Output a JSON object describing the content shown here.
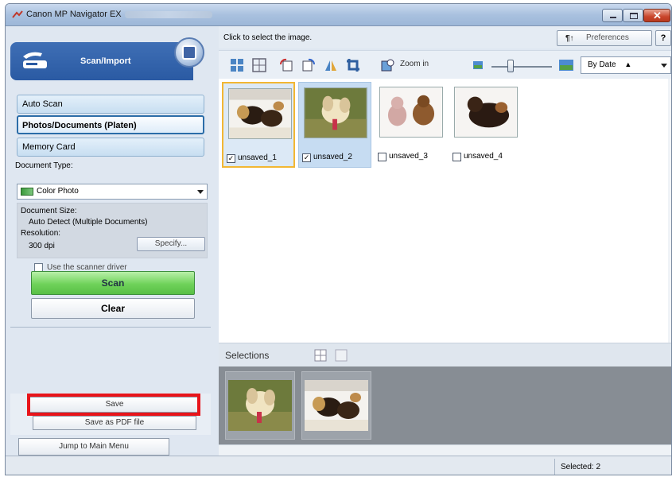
{
  "window": {
    "title": "Canon MP Navigator EX"
  },
  "left_panel": {
    "header_label": "Scan/Import",
    "modes": [
      "Auto Scan",
      "Photos/Documents (Platen)",
      "Memory Card"
    ],
    "selected_mode": "Photos/Documents (Platen)",
    "document_type_label": "Document Type:",
    "document_type_value": "Color Photo",
    "document_size_label": "Document Size:",
    "document_size_value": "Auto Detect (Multiple Documents)",
    "resolution_label": "Resolution:",
    "resolution_value": "300 dpi",
    "specify_label": "Specify...",
    "scanner_driver_label": "Use the scanner driver",
    "scanner_driver_checked": false,
    "scan_label": "Scan",
    "clear_label": "Clear",
    "save_label": "Save",
    "save_pdf_label": "Save as PDF file",
    "jump_label": "Jump to Main Menu"
  },
  "right_panel": {
    "hint": "Click to select the image.",
    "preferences_label": "Preferences",
    "help_label": "?",
    "zoom_label": "Zoom in",
    "sort_value": "By Date",
    "thumbnails": [
      {
        "name": "unsaved_1",
        "checked": true
      },
      {
        "name": "unsaved_2",
        "checked": true
      },
      {
        "name": "unsaved_3",
        "checked": false
      },
      {
        "name": "unsaved_4",
        "checked": false
      }
    ],
    "selections_label": "Selections"
  },
  "status": {
    "selected_text": "Selected: 2"
  },
  "colors": {
    "accent": "#2a5aa3",
    "scan_button": "#6fd25a",
    "highlight": "#e8141a"
  }
}
